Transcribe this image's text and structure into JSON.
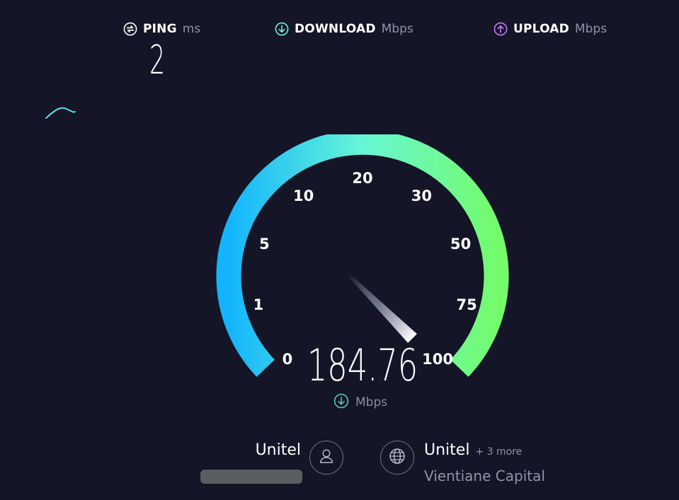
{
  "metrics": {
    "ping": {
      "label": "PING",
      "unit": "ms",
      "value": "2"
    },
    "download": {
      "label": "DOWNLOAD",
      "unit": "Mbps"
    },
    "upload": {
      "label": "UPLOAD",
      "unit": "Mbps"
    }
  },
  "gauge": {
    "ticks": [
      "0",
      "1",
      "5",
      "10",
      "20",
      "30",
      "50",
      "75",
      "100"
    ],
    "speed_value": "184.76",
    "speed_unit": "Mbps",
    "needle_level": "100",
    "colors": {
      "start": "#1ab8ff",
      "mid": "#6cf5d8",
      "end": "#72fa6e"
    }
  },
  "provider": {
    "name": "Unitel"
  },
  "server": {
    "name": "Unitel",
    "more": "+ 3 more",
    "location": "Vientiane Capital"
  },
  "icons": {
    "ping": "ping-icon",
    "download": "download-icon",
    "upload": "upload-icon",
    "user": "user-icon",
    "globe": "globe-icon"
  }
}
